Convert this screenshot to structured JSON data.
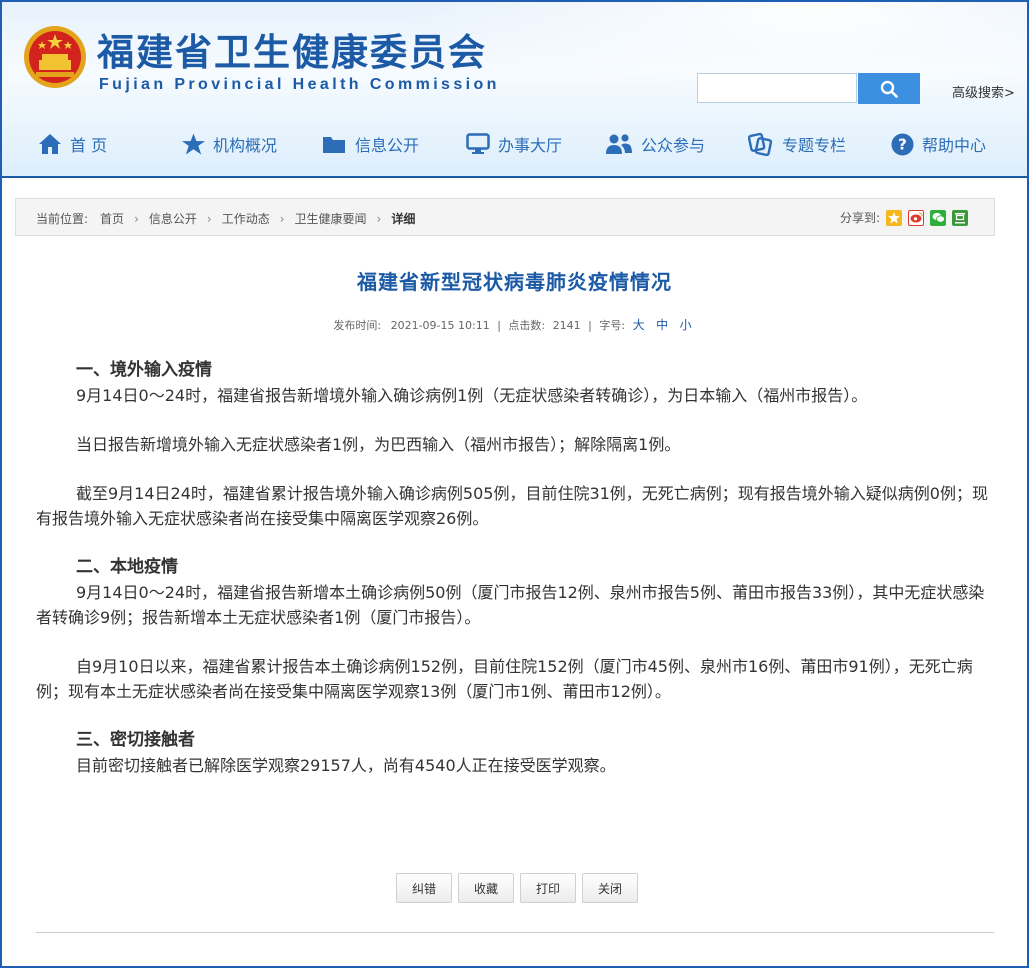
{
  "header": {
    "title": "福建省卫生健康委员会",
    "subtitle": "Fujian Provincial Health Commission",
    "search": {
      "placeholder": "",
      "value": ""
    },
    "advanced_search": "高级搜索>",
    "accent_color": "#1c5aa6"
  },
  "nav": {
    "items": [
      {
        "label": "首  页",
        "icon": "home-icon"
      },
      {
        "label": "机构概况",
        "icon": "star-icon"
      },
      {
        "label": "信息公开",
        "icon": "folder-icon"
      },
      {
        "label": "办事大厅",
        "icon": "monitor-icon"
      },
      {
        "label": "公众参与",
        "icon": "people-icon"
      },
      {
        "label": "专题专栏",
        "icon": "tags-icon"
      },
      {
        "label": "帮助中心",
        "icon": "help-icon"
      }
    ]
  },
  "breadcrumb": {
    "prefix": "当前位置:",
    "items": [
      "首页",
      "信息公开",
      "工作动态",
      "卫生健康要闻"
    ],
    "current": "详细",
    "share_label": "分享到:",
    "share_icons": [
      "qzone-icon",
      "weibo-icon",
      "wechat-icon",
      "douban-icon"
    ]
  },
  "article": {
    "title": "福建省新型冠状病毒肺炎疫情情况",
    "publish_label": "发布时间:",
    "publish_time": "2021-09-15 10:11",
    "clicks_label": "点击数:",
    "clicks": "2141",
    "fontsize_label": "字号:",
    "fontsizes": [
      "大",
      "中",
      "小"
    ],
    "sections": [
      {
        "heading": "一、境外输入疫情",
        "paragraphs": [
          "9月14日0～24时，福建省报告新增境外输入确诊病例1例（无症状感染者转确诊），为日本输入（福州市报告）。",
          "当日报告新增境外输入无症状感染者1例，为巴西输入（福州市报告）；解除隔离1例。",
          "截至9月14日24时，福建省累计报告境外输入确诊病例505例，目前住院31例，无死亡病例；现有报告境外输入疑似病例0例；现有报告境外输入无症状感染者尚在接受集中隔离医学观察26例。"
        ]
      },
      {
        "heading": "二、本地疫情",
        "paragraphs": [
          "9月14日0～24时，福建省报告新增本土确诊病例50例（厦门市报告12例、泉州市报告5例、莆田市报告33例），其中无症状感染者转确诊9例；报告新增本土无症状感染者1例（厦门市报告）。",
          "自9月10日以来，福建省累计报告本土确诊病例152例，目前住院152例（厦门市45例、泉州市16例、莆田市91例），无死亡病例；现有本土无症状感染者尚在接受集中隔离医学观察13例（厦门市1例、莆田市12例）。"
        ]
      },
      {
        "heading": "三、密切接触者",
        "paragraphs": [
          "目前密切接触者已解除医学观察29157人，尚有4540人正在接受医学观察。"
        ]
      }
    ]
  },
  "actions": {
    "correct": "纠错",
    "favorite": "收藏",
    "print": "打印",
    "close": "关闭"
  }
}
